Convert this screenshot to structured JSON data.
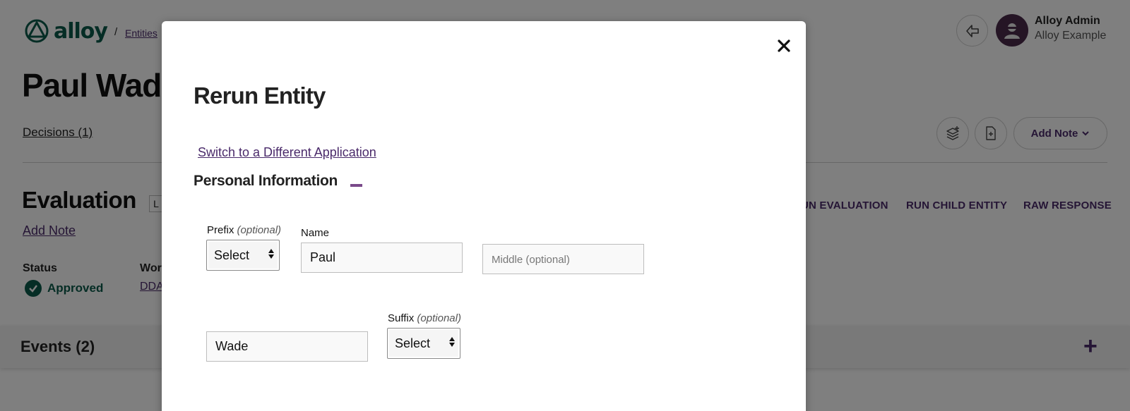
{
  "app": {
    "logo_text": "alloy"
  },
  "breadcrumb": {
    "separator": "/",
    "entities_link": "Entities"
  },
  "user": {
    "name": "Alloy Admin",
    "org": "Alloy Example"
  },
  "entity": {
    "title": "Paul Wade"
  },
  "tabs": {
    "decisions": "Decisions (1)"
  },
  "toolbar": {
    "add_note_label": "Add Note"
  },
  "evaluation": {
    "title": "Evaluation",
    "badge": "L",
    "add_note_link": "Add Note",
    "actions": [
      "UN EVALUATION",
      "RUN CHILD ENTITY",
      "RAW RESPONSE"
    ],
    "status_label": "Status",
    "status_value": "Approved",
    "workflow_label": "Wor",
    "workflow_value": "DDA"
  },
  "events": {
    "title": "Events (2)",
    "add_symbol": "+"
  },
  "modal": {
    "close_symbol": "✕",
    "title": "Rerun Entity",
    "switch_link": "Switch to a Different Application",
    "section_title": "Personal Information",
    "fields": {
      "prefix": {
        "label": "Prefix",
        "optional": "(optional)",
        "value": "Select"
      },
      "name": {
        "label": "Name",
        "first_value": "Paul"
      },
      "middle": {
        "value": "",
        "placeholder": "Middle (optional)"
      },
      "last": {
        "value": "Wade"
      },
      "suffix": {
        "label": "Suffix",
        "optional": "(optional)",
        "value": "Select"
      }
    }
  },
  "colors": {
    "brand_green": "#0a5a4a",
    "accent_purple": "#4a2a6a",
    "overlay": "rgba(0,0,0,0.5)"
  }
}
